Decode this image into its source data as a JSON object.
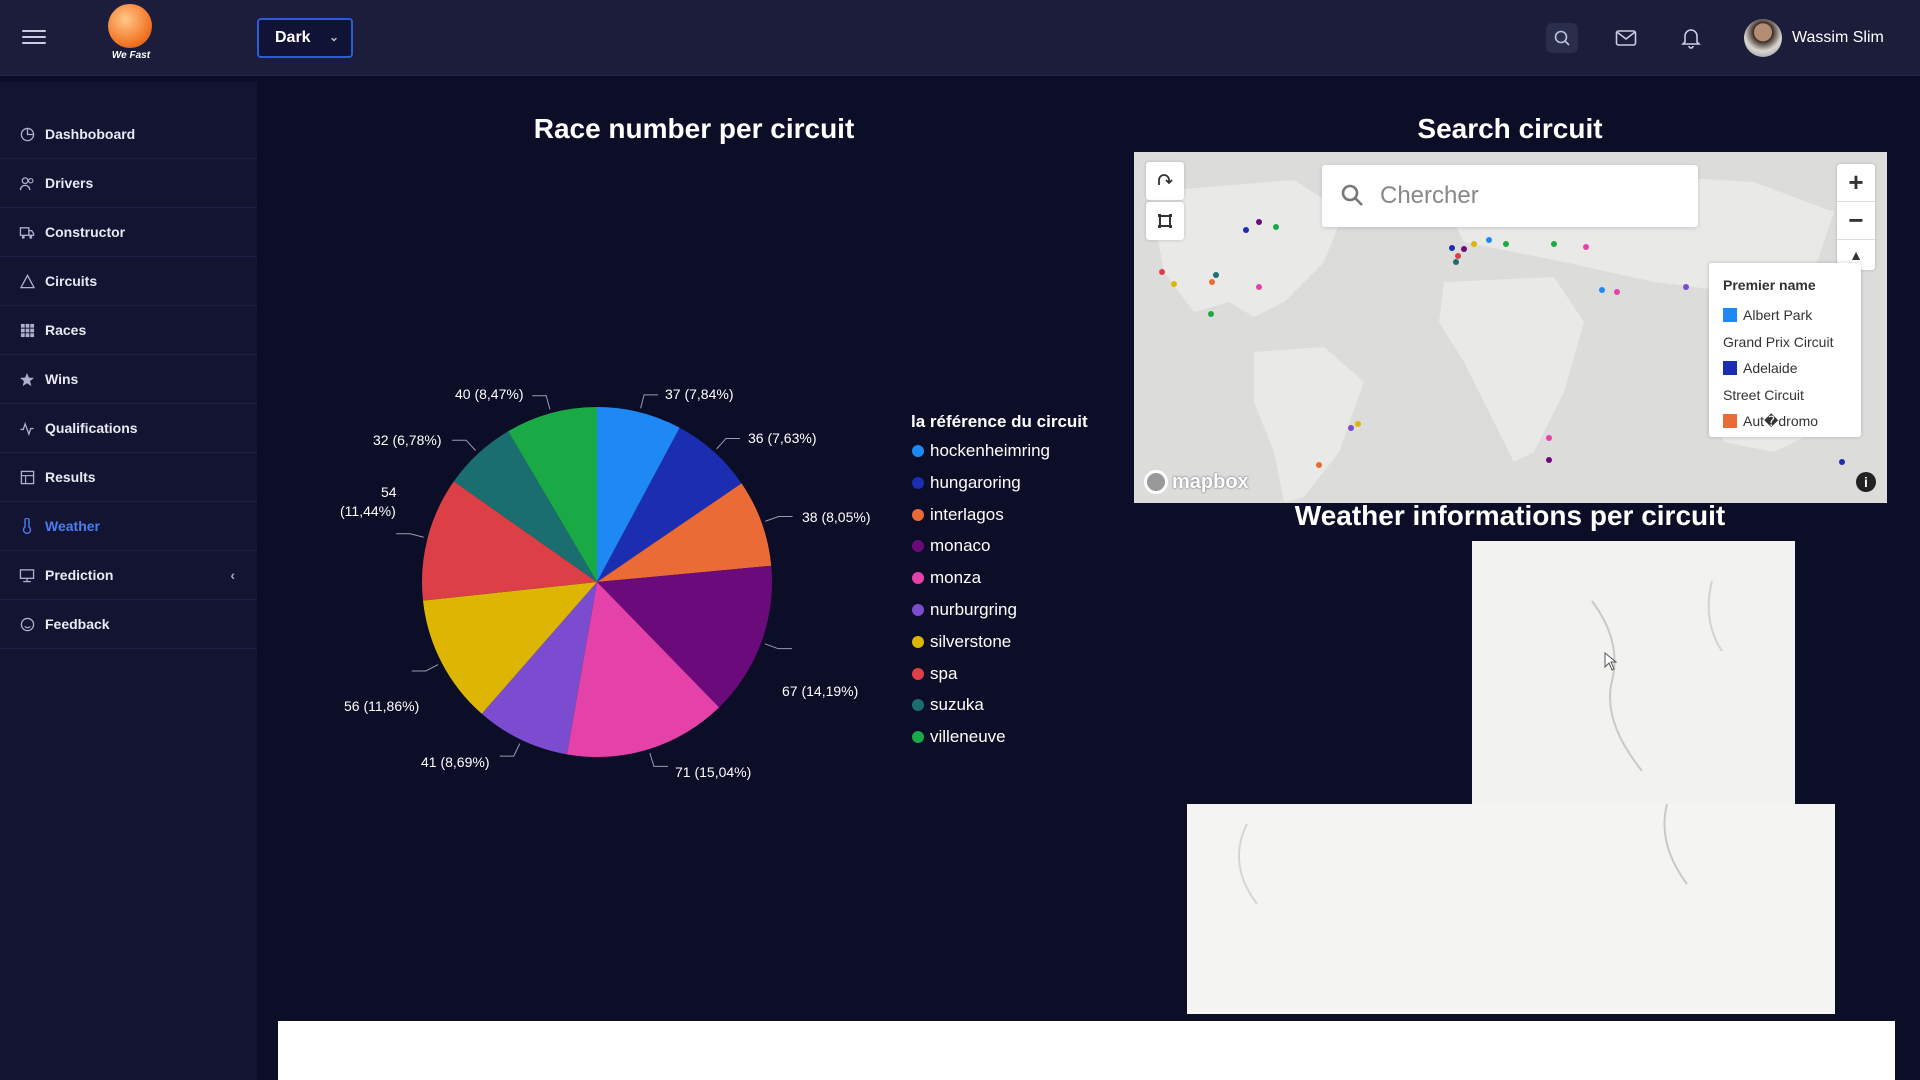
{
  "header": {
    "logo_text": "We Fast",
    "theme": "Dark",
    "user_name": "Wassim Slim"
  },
  "sidebar": {
    "items": [
      {
        "label": "Dashboboard",
        "icon": "pie-chart-icon"
      },
      {
        "label": "Drivers",
        "icon": "users-icon"
      },
      {
        "label": "Constructor",
        "icon": "truck-icon"
      },
      {
        "label": "Circuits",
        "icon": "triangle-icon"
      },
      {
        "label": "Races",
        "icon": "grid-icon"
      },
      {
        "label": "Wins",
        "icon": "star-icon"
      },
      {
        "label": "Qualifications",
        "icon": "activity-icon"
      },
      {
        "label": "Results",
        "icon": "table-icon"
      },
      {
        "label": "Weather",
        "icon": "thermometer-icon"
      },
      {
        "label": "Prediction",
        "icon": "monitor-icon"
      },
      {
        "label": "Feedback",
        "icon": "smile-icon"
      }
    ],
    "active": "Weather"
  },
  "main": {
    "chart_title": "Race number per circuit",
    "map_title": "Search circuit",
    "weather_title": "Weather informations per circuit",
    "legend_title": "la référence du circuit"
  },
  "chart_data": {
    "type": "pie",
    "title": "Race number per circuit",
    "legend_title": "la référence du circuit",
    "slices": [
      {
        "label": "hockenheimring",
        "value": 37,
        "pct": "7,84%",
        "color": "#1e88f5"
      },
      {
        "label": "hungaroring",
        "value": 36,
        "pct": "7,63%",
        "color": "#1b2db0"
      },
      {
        "label": "interlagos",
        "value": 38,
        "pct": "8,05%",
        "color": "#ea6b35"
      },
      {
        "label": "monaco",
        "value": 67,
        "pct": "14,19%",
        "color": "#6b0a7a"
      },
      {
        "label": "monza",
        "value": 71,
        "pct": "15,04%",
        "color": "#e442a8"
      },
      {
        "label": "nurburgring",
        "value": 41,
        "pct": "8,69%",
        "color": "#7b4bd0"
      },
      {
        "label": "silverstone",
        "value": 56,
        "pct": "11,86%",
        "color": "#dcb602"
      },
      {
        "label": "spa",
        "value": 54,
        "pct": "11,44%",
        "color": "#dc4046"
      },
      {
        "label": "suzuka",
        "value": 32,
        "pct": "6,78%",
        "color": "#1b6e70"
      },
      {
        "label": "villeneuve",
        "value": 40,
        "pct": "8,47%",
        "color": "#1aaa45"
      }
    ],
    "data_labels": [
      "37 (7,84%)",
      "36 (7,63%)",
      "38 (8,05%)",
      "67 (14,19%)",
      "71 (15,04%)",
      "41 (8,69%)",
      "56 (11,86%)",
      "54",
      "(11,44%)",
      "32 (6,78%)",
      "40 (8,47%)"
    ]
  },
  "map": {
    "search_placeholder": "Chercher",
    "legend_title": "Premier name",
    "legend_rows": [
      {
        "label": "Albert Park",
        "color": "#1e88f5"
      },
      {
        "label": "Grand Prix Circuit",
        "color": ""
      },
      {
        "label": "Adelaide",
        "color": "#1b2db0"
      },
      {
        "label": "Street Circuit",
        "color": ""
      },
      {
        "label": "Aut�dromo",
        "color": "#ea6b35"
      }
    ],
    "attribution": "mapbox",
    "zoom_in": "+",
    "zoom_out": "−",
    "compass": "▲"
  }
}
